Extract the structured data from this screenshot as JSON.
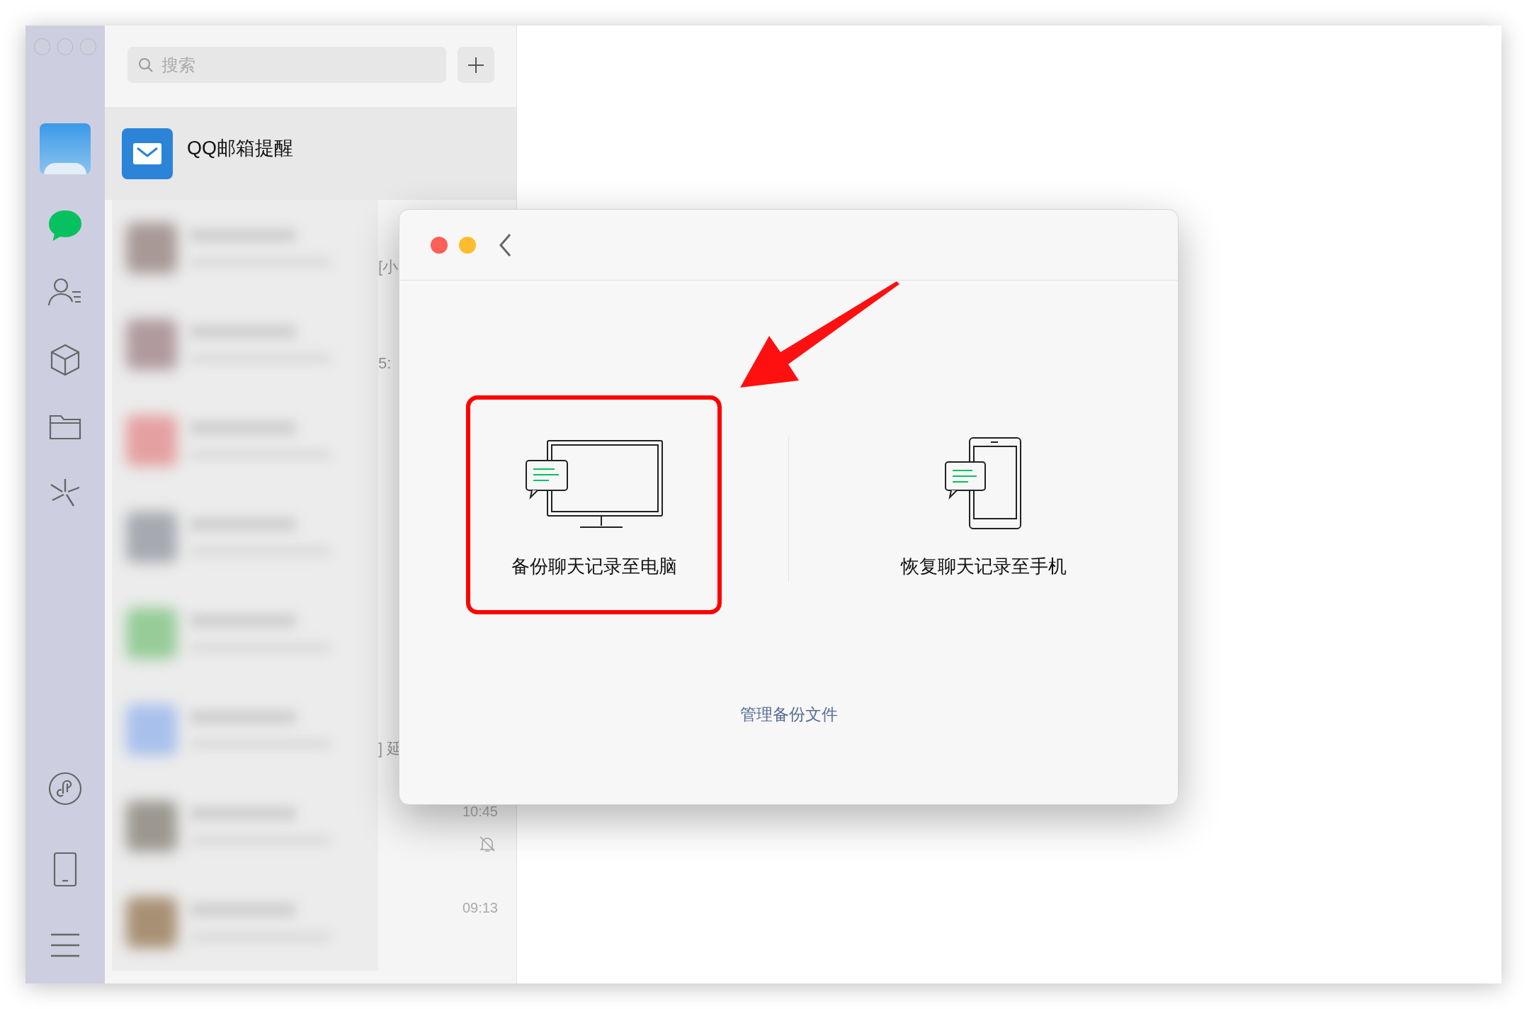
{
  "sidebar": {
    "top_items": [
      {
        "kind": "avatar",
        "selected": false
      },
      {
        "kind": "chats",
        "selected": true
      },
      {
        "kind": "contacts",
        "selected": false
      },
      {
        "kind": "favorites",
        "selected": false
      },
      {
        "kind": "files",
        "selected": false
      },
      {
        "kind": "moments",
        "selected": false
      }
    ],
    "bottom_items": [
      {
        "kind": "miniprograms",
        "selected": false
      },
      {
        "kind": "phone",
        "selected": false
      },
      {
        "kind": "menu",
        "selected": false
      }
    ]
  },
  "chat_list": {
    "search": {
      "placeholder": "搜索"
    },
    "pinned": {
      "title": "QQ邮箱提醒"
    },
    "rows": [
      {
        "color": "#a89896",
        "preview": "[小"
      },
      {
        "color": "#b09a9e",
        "preview": "5:"
      },
      {
        "color": "#e4a0a0"
      },
      {
        "color": "#a6aab0"
      },
      {
        "color": "#96cc98"
      },
      {
        "color": "#a8c0ec",
        "preview": "] 延"
      },
      {
        "color": "#9c9890",
        "time": "10:45",
        "muted": true
      },
      {
        "color": "#a89074",
        "time": "09:13",
        "muted": false
      }
    ]
  },
  "dialog": {
    "options": [
      {
        "kind": "computer",
        "label": "备份聊天记录至电脑",
        "highlighted": true
      },
      {
        "kind": "phone",
        "label": "恢复聊天记录至手机",
        "highlighted": false
      }
    ],
    "link": "管理备份文件"
  }
}
